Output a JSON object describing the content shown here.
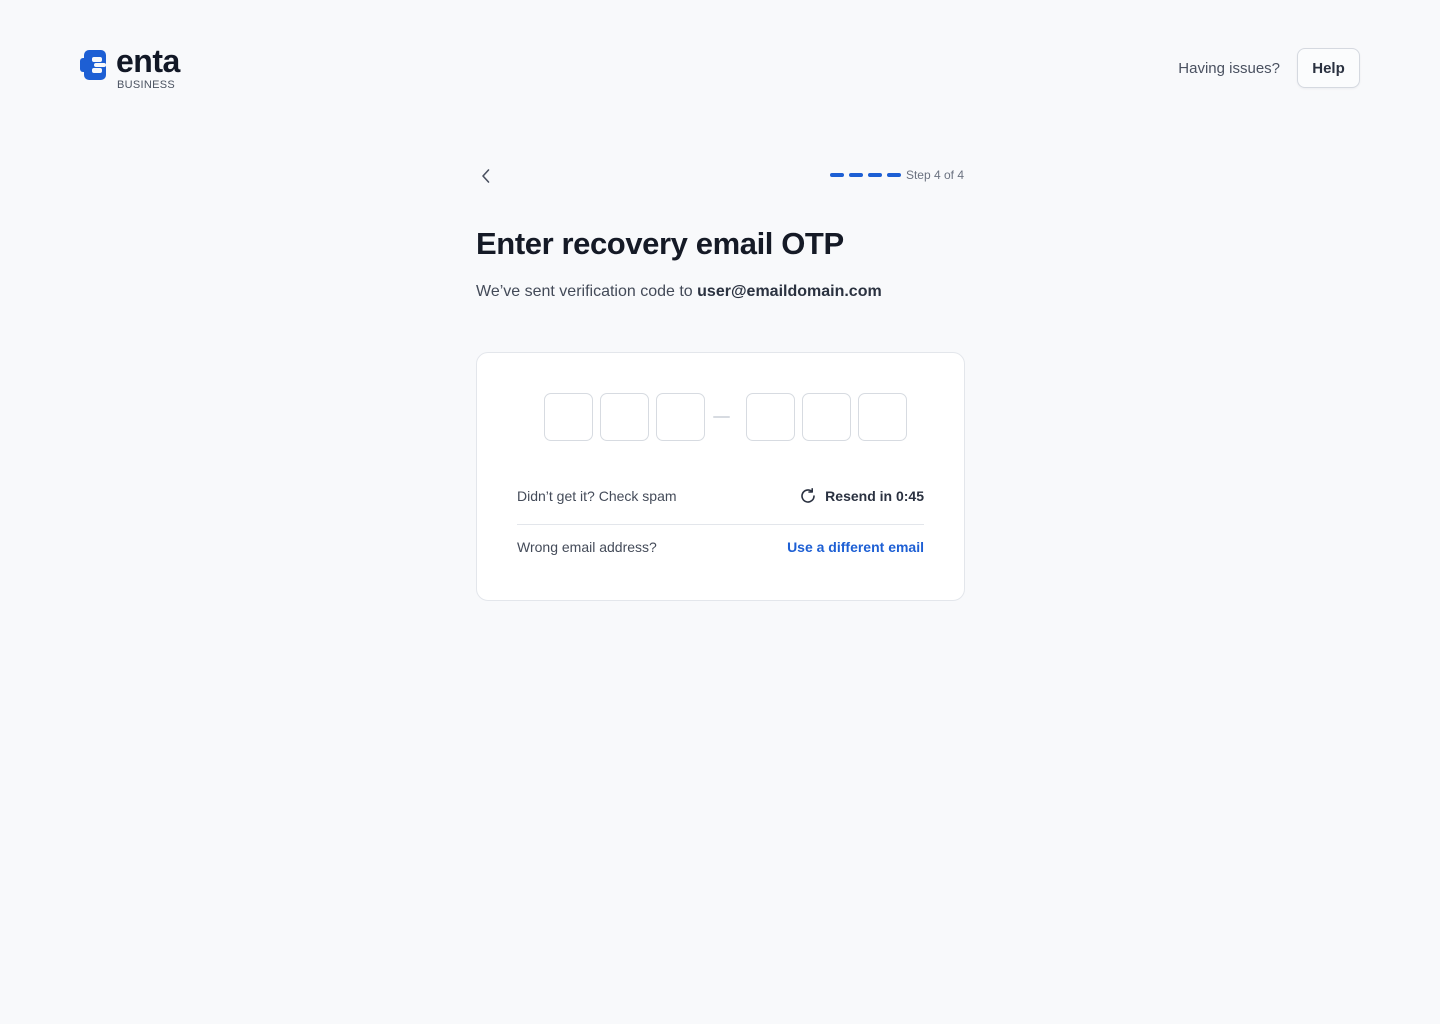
{
  "brand": {
    "name": "enta",
    "subtitle": "BUSINESS",
    "accent": "#1d5fd4"
  },
  "header": {
    "issues_text": "Having issues?",
    "help_label": "Help"
  },
  "stepper": {
    "current": 4,
    "total": 4,
    "label": "Step 4 of 4"
  },
  "main": {
    "title": "Enter recovery email OTP",
    "subtitle_prefix": "We’ve sent verification code to",
    "email": "user@emaildomain.com"
  },
  "otp": {
    "digits": [
      "",
      "",
      "",
      "",
      "",
      ""
    ]
  },
  "card": {
    "spam_text": "Didn’t get it? Check spam",
    "resend_label": "Resend in 0:45",
    "wrong_email_text": "Wrong email address?",
    "different_email_label": "Use a different email"
  },
  "icons": {
    "back": "chevron-left-icon",
    "resend": "refresh-icon"
  }
}
